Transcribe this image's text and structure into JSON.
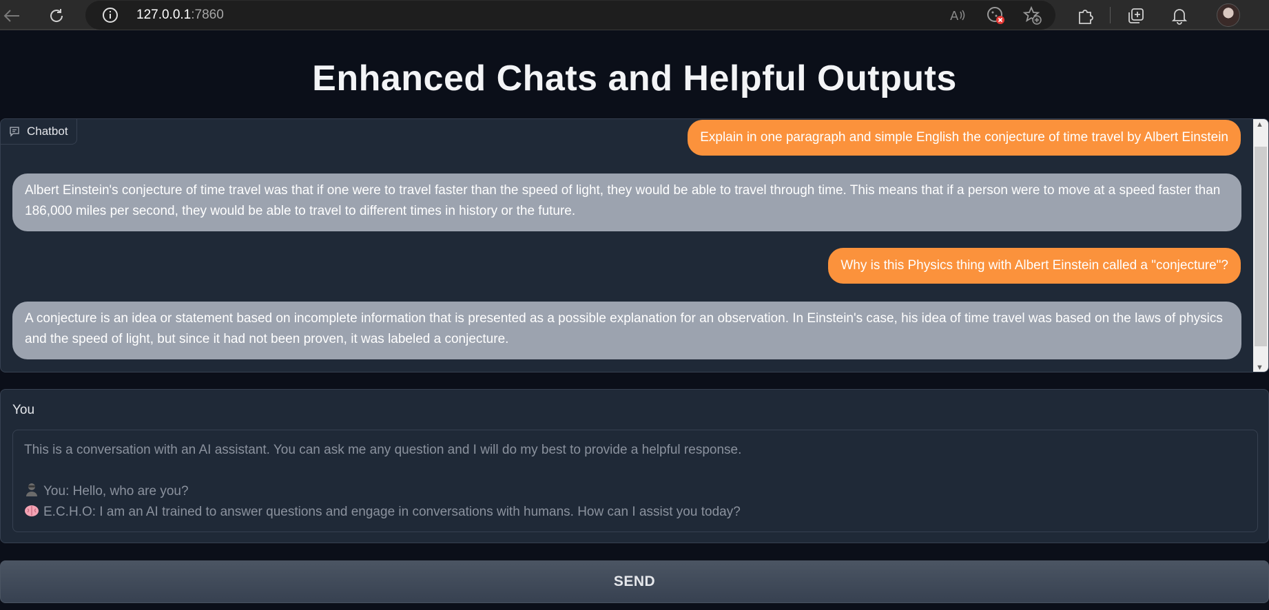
{
  "browser": {
    "url_host": "127.0.0.1",
    "url_port": ":7860"
  },
  "page": {
    "title": "Enhanced Chats and Helpful Outputs"
  },
  "chatbot": {
    "label": "Chatbot",
    "messages": [
      {
        "role": "user",
        "text": "Explain in one paragraph and simple English the conjecture of time travel by Albert Einstein"
      },
      {
        "role": "bot",
        "text": "Albert Einstein's conjecture of time travel was that if one were to travel faster than the speed of light, they would be able to travel through time. This means that if a person were to move at a speed faster than 186,000 miles per second, they would be able to travel to different times in history or the future."
      },
      {
        "role": "user",
        "text": "Why is this Physics thing with Albert Einstein called a \"conjecture\"?"
      },
      {
        "role": "bot",
        "text": "A conjecture is an idea or statement based on incomplete information that is presented as a possible explanation for an observation. In Einstein's case, his idea of time travel was based on the laws of physics and the speed of light, but since it had not been proven, it was labeled a conjecture."
      }
    ]
  },
  "input": {
    "label": "You",
    "placeholder_line1": "This is a conversation with an AI assistant. You can ask me any question and I will do my best to provide a helpful response.",
    "placeholder_line2": "You:  Hello, who are you?",
    "placeholder_line3": "E.C.H.O:  I am an AI trained to answer questions and engage in conversations with humans. How can I assist you today?"
  },
  "send_label": "SEND",
  "colors": {
    "user_bubble": "#fb923c",
    "bot_bubble": "#9ca3af",
    "background": "#0b0f19",
    "panel": "#1f2937"
  }
}
